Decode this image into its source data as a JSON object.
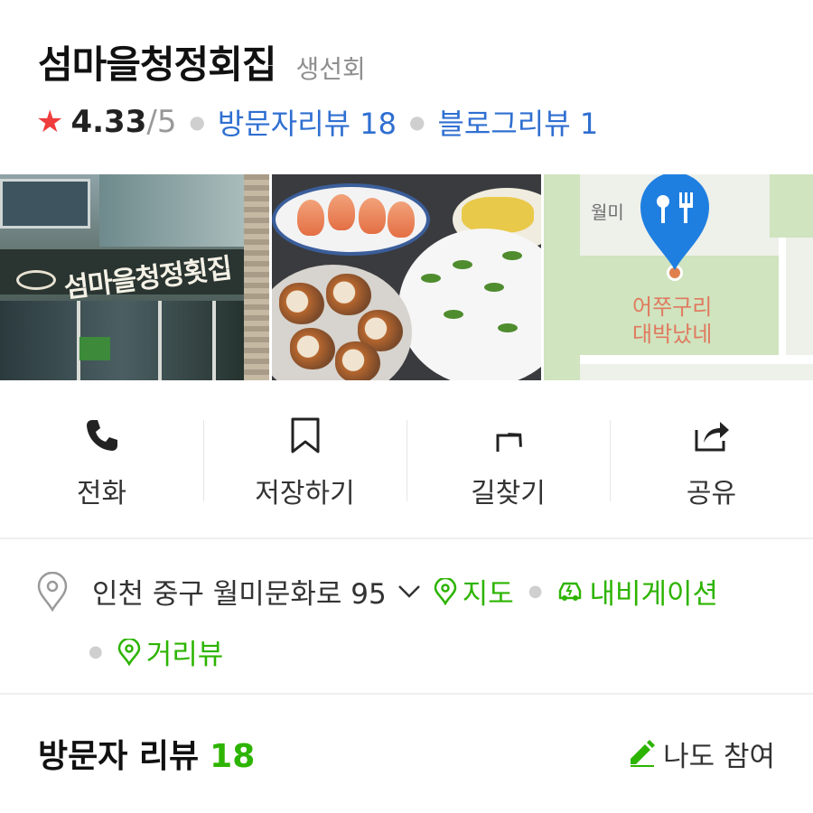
{
  "place": {
    "name": "섬마을청정회집",
    "category": "생선회"
  },
  "rating": {
    "star": "★",
    "score": "4.33",
    "max": "/5",
    "visitor_reviews": "방문자리뷰 18",
    "blog_reviews": "블로그리뷰 1"
  },
  "photos": {
    "storefront_sign": "섬마을청정횟집",
    "map_label_top": "월미",
    "map_place_line1": "어쭈구리",
    "map_place_line2": "대박났네"
  },
  "actions": [
    {
      "label": "전화",
      "icon": "phone-icon"
    },
    {
      "label": "저장하기",
      "icon": "bookmark-icon"
    },
    {
      "label": "길찾기",
      "icon": "directions-icon"
    },
    {
      "label": "공유",
      "icon": "share-icon"
    }
  ],
  "address": {
    "text": "인천 중구 월미문화로 95",
    "map_link": "지도",
    "navigation_link": "내비게이션",
    "street_view_link": "거리뷰"
  },
  "reviews": {
    "title": "방문자 리뷰",
    "count": "18",
    "join_label": "나도 참여"
  },
  "colors": {
    "link_blue": "#2f6fd1",
    "green": "#2db400",
    "star_red": "#ef3c3c",
    "pin_blue": "#1f7fe0"
  }
}
